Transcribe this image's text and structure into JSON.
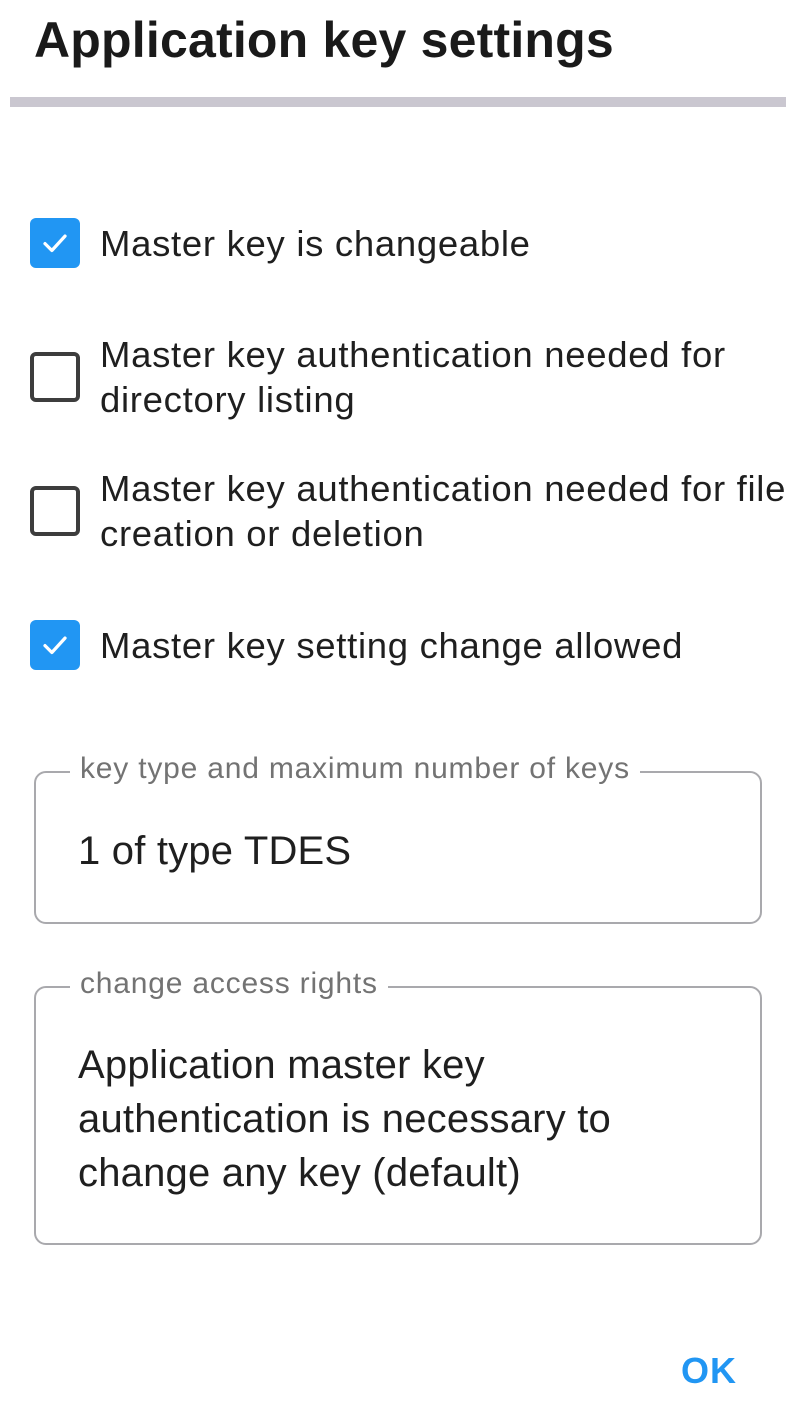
{
  "dialog": {
    "title": "Application key settings"
  },
  "options": [
    {
      "label": "Master key is changeable",
      "checked": true
    },
    {
      "label": "Master key authentication needed for directory listing",
      "checked": false
    },
    {
      "label": "Master key authentication needed for file creation or deletion",
      "checked": false
    },
    {
      "label": "Master key setting change allowed",
      "checked": true
    }
  ],
  "key_type_field": {
    "label": "key type and maximum number of keys",
    "value": "1 of type TDES"
  },
  "access_rights_field": {
    "label": "change access rights",
    "value": "Application master key authentication is necessary to change any key (default)"
  },
  "actions": {
    "ok_label": "OK"
  },
  "colors": {
    "accent": "#2196f3",
    "divider": "#cac7d0",
    "outline": "#a9a9ad"
  },
  "icons": {
    "checked": "check-icon"
  }
}
